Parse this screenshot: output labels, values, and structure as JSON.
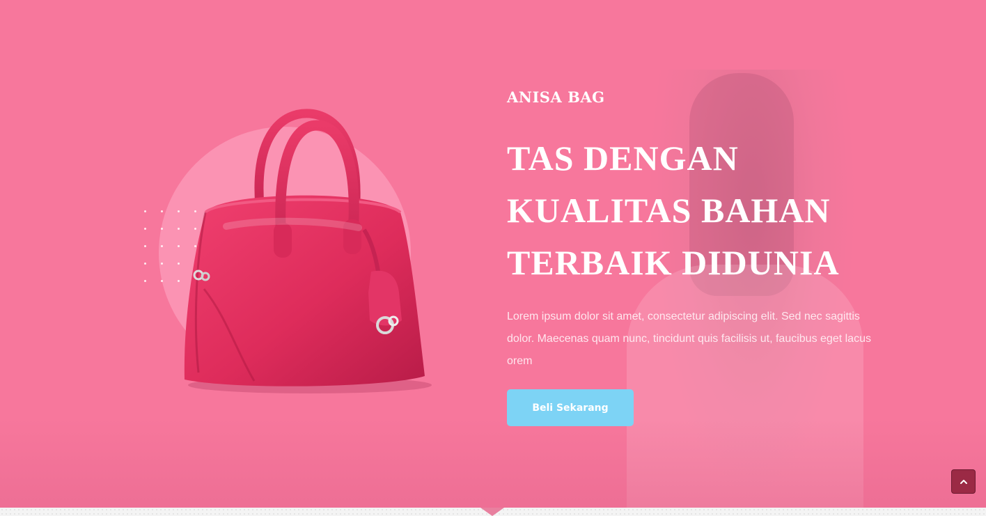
{
  "hero": {
    "brand": "ANISA BAG",
    "headline_lines": [
      "TAS DENGAN",
      "KUALITAS BAHAN",
      "TERBAIK DIDUNIA"
    ],
    "description": "Lorem ipsum dolor sit amet, consectetur adipiscing elit. Sed nec sagittis dolor. Maecenas quam nunc, tincidunt quis facilisis ut, faucibus eget lacus orem",
    "cta_label": "Beli Sekarang"
  },
  "icons": {
    "scroll_top": "chevron-up-icon",
    "product": "handbag-image"
  },
  "colors": {
    "background": "#f7779c",
    "circle": "#fb93b3",
    "bag": "#e0305f",
    "cta": "#7dd3f5",
    "scroll_top": "#9b2a45"
  }
}
